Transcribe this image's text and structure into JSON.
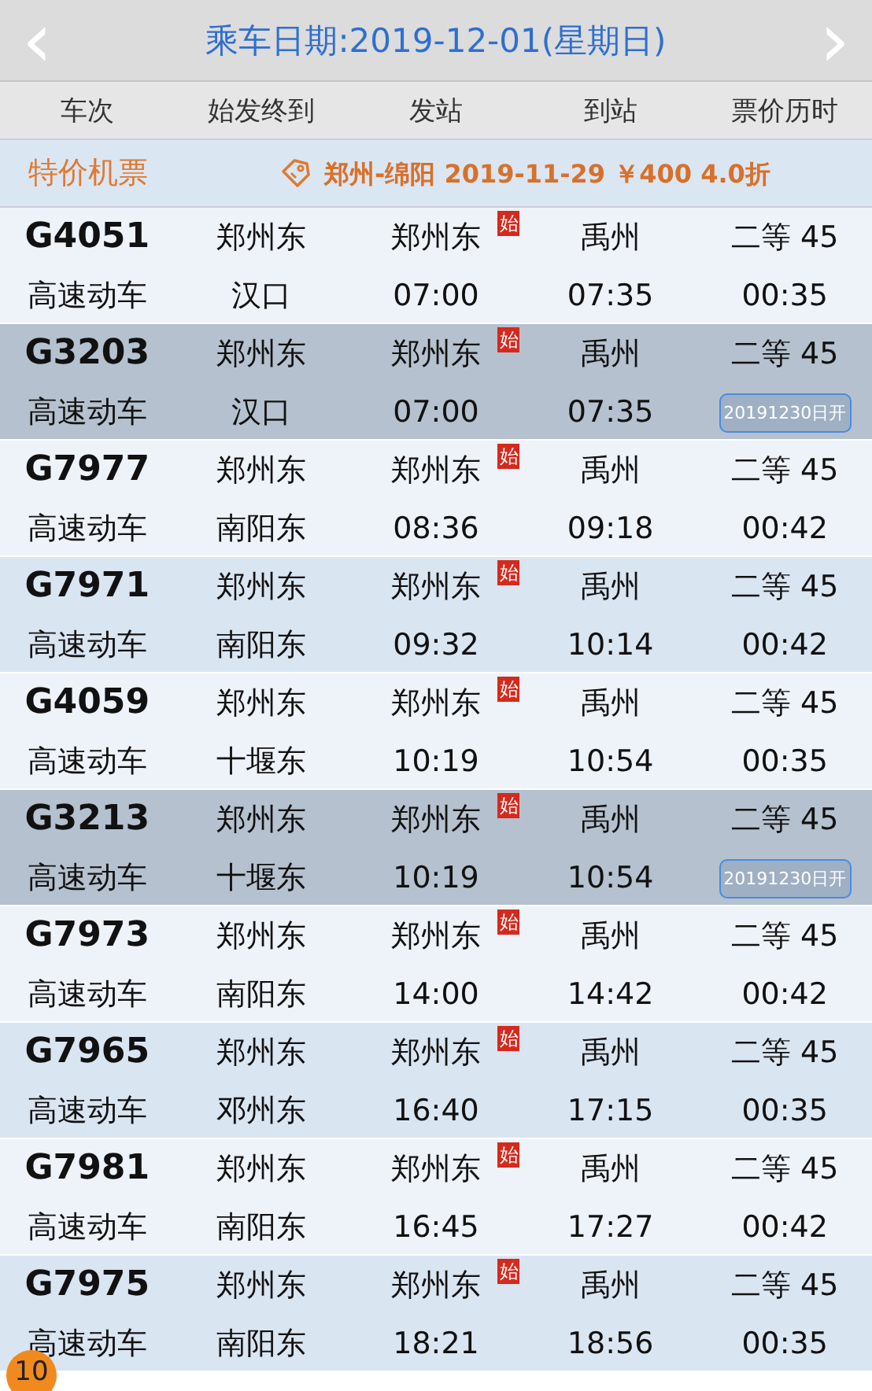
{
  "header": {
    "prev": "‹",
    "title": "乘车日期:2019-12-01(星期日)",
    "next": "›"
  },
  "columns": [
    "车次",
    "始发终到",
    "发站",
    "到站",
    "票价历时"
  ],
  "promo": {
    "label": "特价机票",
    "text": "郑州-绵阳 2019-11-29 ￥400 4.0折"
  },
  "trains": [
    {
      "number": "G4051",
      "type": "高速动车",
      "origin": "郑州东",
      "terminus": "汉口",
      "from": "郑州东",
      "start_mark": "始",
      "depart": "07:00",
      "to": "禹州",
      "arrive": "07:35",
      "price": "二等 45",
      "duration": "00:35",
      "highlighted": false
    },
    {
      "number": "G3203",
      "type": "高速动车",
      "origin": "郑州东",
      "terminus": "汉口",
      "from": "郑州东",
      "start_mark": "始",
      "depart": "07:00",
      "to": "禹州",
      "arrive": "07:35",
      "price": "二等 45",
      "sale_note": "20191230日开",
      "highlighted": true
    },
    {
      "number": "G7977",
      "type": "高速动车",
      "origin": "郑州东",
      "terminus": "南阳东",
      "from": "郑州东",
      "start_mark": "始",
      "depart": "08:36",
      "to": "禹州",
      "arrive": "09:18",
      "price": "二等 45",
      "duration": "00:42",
      "highlighted": false
    },
    {
      "number": "G7971",
      "type": "高速动车",
      "origin": "郑州东",
      "terminus": "南阳东",
      "from": "郑州东",
      "start_mark": "始",
      "depart": "09:32",
      "to": "禹州",
      "arrive": "10:14",
      "price": "二等 45",
      "duration": "00:42",
      "highlighted": false
    },
    {
      "number": "G4059",
      "type": "高速动车",
      "origin": "郑州东",
      "terminus": "十堰东",
      "from": "郑州东",
      "start_mark": "始",
      "depart": "10:19",
      "to": "禹州",
      "arrive": "10:54",
      "price": "二等 45",
      "duration": "00:35",
      "highlighted": false
    },
    {
      "number": "G3213",
      "type": "高速动车",
      "origin": "郑州东",
      "terminus": "十堰东",
      "from": "郑州东",
      "start_mark": "始",
      "depart": "10:19",
      "to": "禹州",
      "arrive": "10:54",
      "price": "二等 45",
      "sale_note": "20191230日开",
      "highlighted": true
    },
    {
      "number": "G7973",
      "type": "高速动车",
      "origin": "郑州东",
      "terminus": "南阳东",
      "from": "郑州东",
      "start_mark": "始",
      "depart": "14:00",
      "to": "禹州",
      "arrive": "14:42",
      "price": "二等 45",
      "duration": "00:42",
      "highlighted": false
    },
    {
      "number": "G7965",
      "type": "高速动车",
      "origin": "郑州东",
      "terminus": "邓州东",
      "from": "郑州东",
      "start_mark": "始",
      "depart": "16:40",
      "to": "禹州",
      "arrive": "17:15",
      "price": "二等 45",
      "duration": "00:35",
      "highlighted": false
    },
    {
      "number": "G7981",
      "type": "高速动车",
      "origin": "郑州东",
      "terminus": "南阳东",
      "from": "郑州东",
      "start_mark": "始",
      "depart": "16:45",
      "to": "禹州",
      "arrive": "17:27",
      "price": "二等 45",
      "duration": "00:42",
      "highlighted": false
    },
    {
      "number": "G7975",
      "type": "高速动车",
      "origin": "郑州东",
      "terminus": "南阳东",
      "from": "郑州东",
      "start_mark": "始",
      "depart": "18:21",
      "to": "禹州",
      "arrive": "18:56",
      "price": "二等 45",
      "duration": "00:35",
      "highlighted": false
    }
  ],
  "count_badge": "10"
}
